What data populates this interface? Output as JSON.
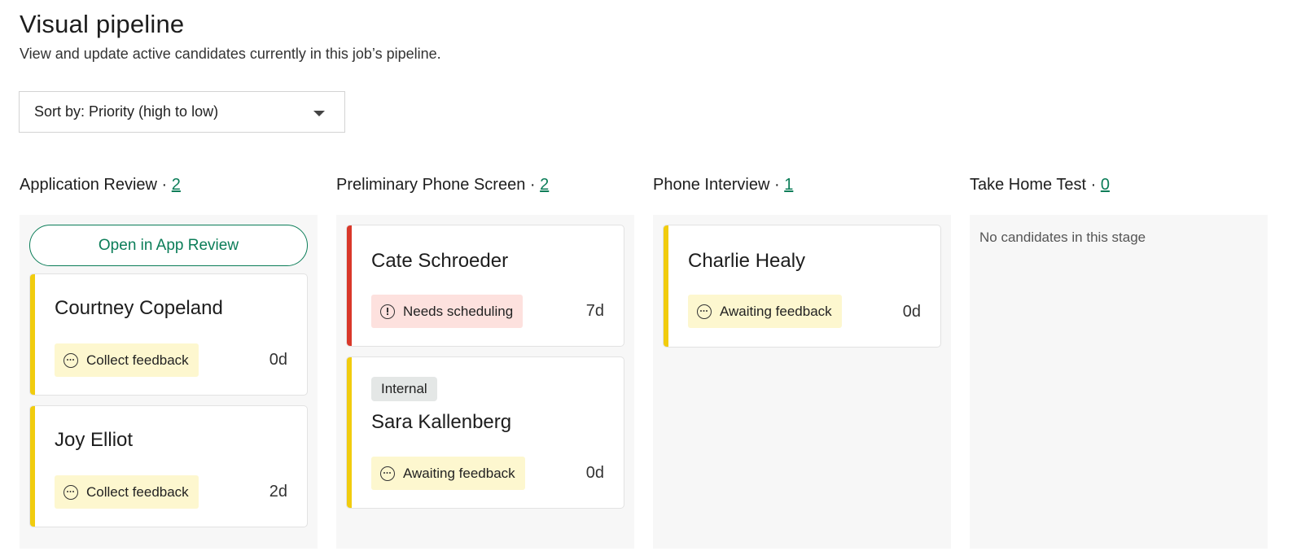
{
  "header": {
    "title": "Visual pipeline",
    "subtitle": "View and update active candidates currently in this job’s pipeline."
  },
  "sort": {
    "label": "Sort by: Priority (high to low)"
  },
  "colors": {
    "accent_green": "#0b7d58",
    "stripe_yellow": "#f1cc0e",
    "stripe_red": "#d9382a",
    "status_yellow_bg": "#fdf7cf",
    "status_red_bg": "#fde1de"
  },
  "columns": [
    {
      "title": "Application Review",
      "separator": "·",
      "count": "2",
      "open_button": "Open in App Review",
      "cards": [
        {
          "name": "Courtney Copeland",
          "status": "Collect feedback",
          "status_icon": "ellipsis-circle-icon",
          "days": "0d"
        },
        {
          "name": "Joy Elliot",
          "status": "Collect feedback",
          "status_icon": "ellipsis-circle-icon",
          "days": "2d"
        }
      ]
    },
    {
      "title": "Preliminary Phone Screen",
      "separator": "·",
      "count": "2",
      "cards": [
        {
          "name": "Cate Schroeder",
          "status": "Needs scheduling",
          "status_icon": "alert-circle-icon",
          "days": "7d"
        },
        {
          "tag": "Internal",
          "name": "Sara Kallenberg",
          "status": "Awaiting feedback",
          "status_icon": "ellipsis-circle-icon",
          "days": "0d"
        }
      ]
    },
    {
      "title": "Phone Interview",
      "separator": "·",
      "count": "1",
      "cards": [
        {
          "name": "Charlie Healy",
          "status": "Awaiting feedback",
          "status_icon": "ellipsis-circle-icon",
          "days": "0d"
        }
      ]
    },
    {
      "title": "Take Home Test",
      "separator": "·",
      "count": "0",
      "empty_text": "No candidates in this stage",
      "cards": []
    }
  ]
}
